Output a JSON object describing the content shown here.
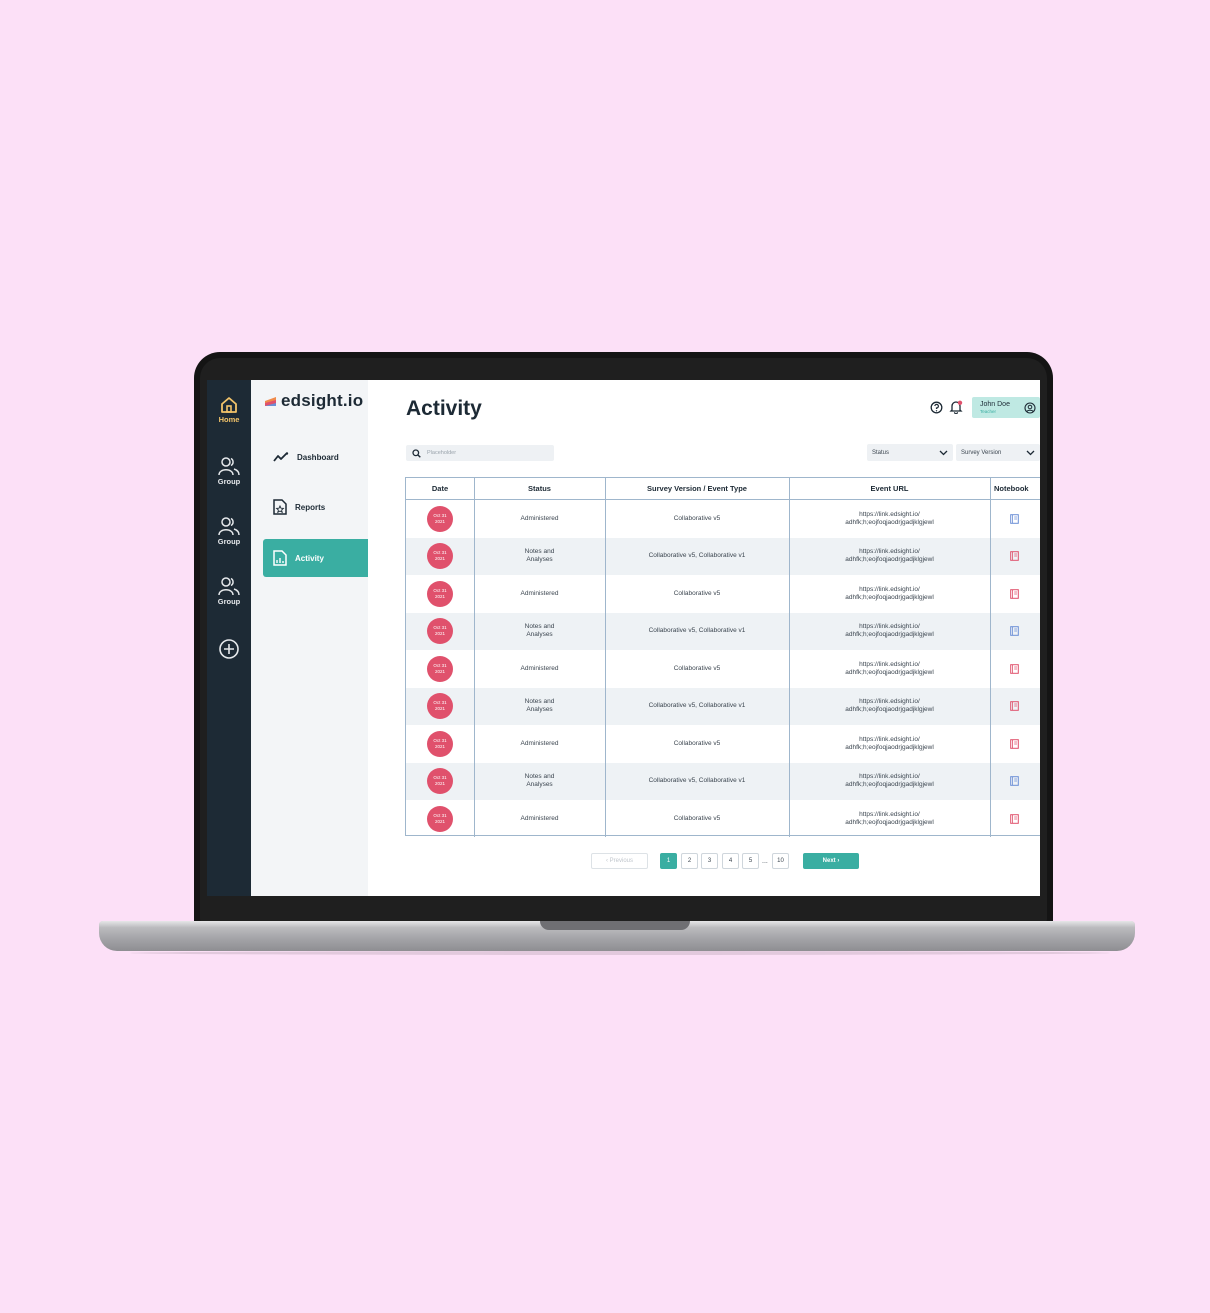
{
  "app": {
    "logo_text": "edsight.io"
  },
  "rail": {
    "items": [
      {
        "label": "Home",
        "icon": "home-icon"
      },
      {
        "label": "Group",
        "icon": "group-icon"
      },
      {
        "label": "Group",
        "icon": "group-icon"
      },
      {
        "label": "Group",
        "icon": "group-icon"
      }
    ],
    "add_icon": "plus-circle-icon"
  },
  "sidebar": {
    "items": [
      {
        "label": "Dashboard",
        "icon": "trend-line-icon"
      },
      {
        "label": "Reports",
        "icon": "report-icon"
      },
      {
        "label": "Activity",
        "icon": "activity-chart-icon"
      }
    ],
    "active": "Activity"
  },
  "header": {
    "title": "Activity",
    "user_name": "John Doe",
    "user_role": "Teacher"
  },
  "filters": {
    "search_placeholder": "Placeholder",
    "status_label": "Status",
    "survey_version_label": "Survey Version"
  },
  "table": {
    "columns": [
      "Date",
      "Status",
      "Survey Version / Event Type",
      "Event URL",
      "Notebook"
    ],
    "rows": [
      {
        "date_line1": "Oct 31",
        "date_line2": "2021",
        "status": "Administered",
        "survey": "Collaborative v5",
        "url_line1": "https://link.edsight.io/",
        "url_line2": "adhfk;h;eojfoqjaodrjgadjklgjewl",
        "notebook_color": "#6b8fd6"
      },
      {
        "date_line1": "Oct 31",
        "date_line2": "2021",
        "status": "Notes and Analyses",
        "survey": "Collaborative v5, Collaborative v1",
        "url_line1": "https://link.edsight.io/",
        "url_line2": "adhfk;h;eojfoqjaodrjgadjklgjewl",
        "notebook_color": "#e0516c"
      },
      {
        "date_line1": "Oct 31",
        "date_line2": "2021",
        "status": "Administered",
        "survey": "Collaborative v5",
        "url_line1": "https://link.edsight.io/",
        "url_line2": "adhfk;h;eojfoqjaodrjgadjklgjewl",
        "notebook_color": "#e0516c"
      },
      {
        "date_line1": "Oct 31",
        "date_line2": "2021",
        "status": "Notes and Analyses",
        "survey": "Collaborative v5, Collaborative v1",
        "url_line1": "https://link.edsight.io/",
        "url_line2": "adhfk;h;eojfoqjaodrjgadjklgjewl",
        "notebook_color": "#6b8fd6"
      },
      {
        "date_line1": "Oct 31",
        "date_line2": "2021",
        "status": "Administered",
        "survey": "Collaborative v5",
        "url_line1": "https://link.edsight.io/",
        "url_line2": "adhfk;h;eojfoqjaodrjgadjklgjewl",
        "notebook_color": "#e0516c"
      },
      {
        "date_line1": "Oct 31",
        "date_line2": "2021",
        "status": "Notes and Analyses",
        "survey": "Collaborative v5, Collaborative v1",
        "url_line1": "https://link.edsight.io/",
        "url_line2": "adhfk;h;eojfoqjaodrjgadjklgjewl",
        "notebook_color": "#e0516c"
      },
      {
        "date_line1": "Oct 31",
        "date_line2": "2021",
        "status": "Administered",
        "survey": "Collaborative v5",
        "url_line1": "https://link.edsight.io/",
        "url_line2": "adhfk;h;eojfoqjaodrjgadjklgjewl",
        "notebook_color": "#e0516c"
      },
      {
        "date_line1": "Oct 31",
        "date_line2": "2021",
        "status": "Notes and Analyses",
        "survey": "Collaborative v5, Collaborative v1",
        "url_line1": "https://link.edsight.io/",
        "url_line2": "adhfk;h;eojfoqjaodrjgadjklgjewl",
        "notebook_color": "#6b8fd6"
      },
      {
        "date_line1": "Oct 31",
        "date_line2": "2021",
        "status": "Administered",
        "survey": "Collaborative v5",
        "url_line1": "https://link.edsight.io/",
        "url_line2": "adhfk;h;eojfoqjaodrjgadjklgjewl",
        "notebook_color": "#e0516c"
      }
    ]
  },
  "pagination": {
    "previous_label": "‹ Previous",
    "pages": [
      "1",
      "2",
      "3",
      "4",
      "5"
    ],
    "ellipsis": "...",
    "last_page": "10",
    "current": "1",
    "next_label": "Next ›"
  },
  "colors": {
    "accent": "#3aaea2",
    "rail_bg": "#1d2a35",
    "date_badge": "#e0516c",
    "page_bg": "#fce0f7"
  }
}
